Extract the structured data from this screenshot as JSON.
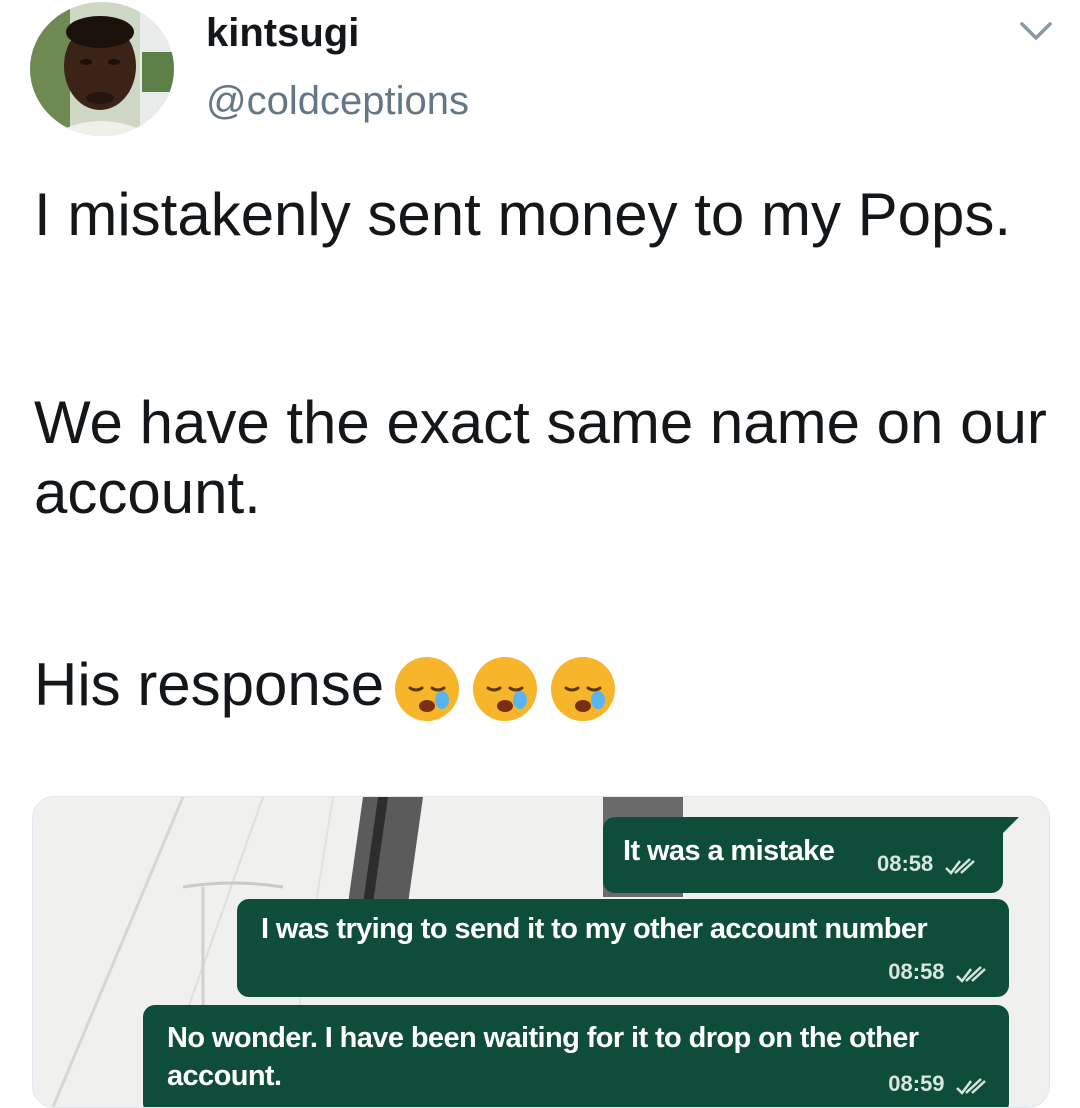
{
  "author": {
    "display_name": "kintsugi",
    "handle": "@coldceptions"
  },
  "tweet": {
    "line1": "I mistakenly sent money to my Pops.",
    "line2": "We have the exact same name on our account.",
    "line3": "His response",
    "emojis": [
      "sleepy-face-emoji",
      "sleepy-face-emoji",
      "sleepy-face-emoji"
    ]
  },
  "chat": {
    "messages": [
      {
        "text": "It was a mistake",
        "time": "08:58",
        "status": "read-double-tick"
      },
      {
        "text": "I was trying to send it to my other account number",
        "time": "08:58",
        "status": "read-double-tick"
      },
      {
        "text": "No wonder. I have been waiting for it to drop on the other account.",
        "time": "08:59",
        "status": "read-double-tick"
      }
    ],
    "bubble_color": "#0d4d3a"
  },
  "icons": {
    "menu": "chevron-down-icon"
  },
  "colors": {
    "text": "#14171a",
    "handle": "#657786",
    "chevron": "#8899a6"
  }
}
